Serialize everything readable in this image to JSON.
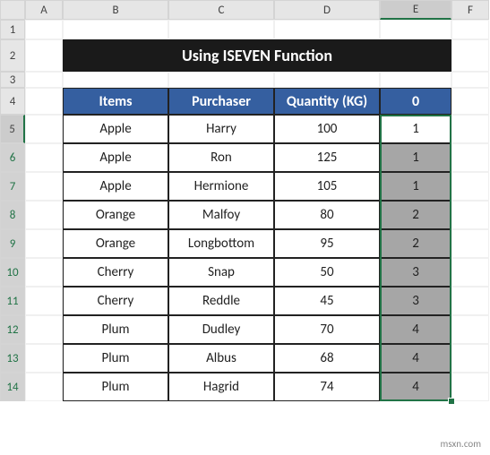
{
  "cols": [
    "A",
    "B",
    "C",
    "D",
    "E",
    "F"
  ],
  "rows": [
    "1",
    "2",
    "3",
    "4",
    "5",
    "6",
    "7",
    "8",
    "9",
    "10",
    "11",
    "12",
    "13",
    "14"
  ],
  "title": "Using ISEVEN Function",
  "headers": {
    "b": "Items",
    "c": "Purchaser",
    "d": "Quantity (KG)",
    "e": "0"
  },
  "chart_data": {
    "type": "table",
    "columns": [
      "Items",
      "Purchaser",
      "Quantity (KG)",
      "0"
    ],
    "rows": [
      {
        "item": "Apple",
        "purchaser": "Harry",
        "qty": "100",
        "grp": "1"
      },
      {
        "item": "Apple",
        "purchaser": "Ron",
        "qty": "125",
        "grp": "1"
      },
      {
        "item": "Apple",
        "purchaser": "Hermione",
        "qty": "105",
        "grp": "1"
      },
      {
        "item": "Orange",
        "purchaser": "Malfoy",
        "qty": "80",
        "grp": "2"
      },
      {
        "item": "Orange",
        "purchaser": "Longbottom",
        "qty": "95",
        "grp": "2"
      },
      {
        "item": "Cherry",
        "purchaser": "Snap",
        "qty": "50",
        "grp": "3"
      },
      {
        "item": "Cherry",
        "purchaser": "Reddle",
        "qty": "45",
        "grp": "3"
      },
      {
        "item": "Plum",
        "purchaser": "Dudley",
        "qty": "70",
        "grp": "4"
      },
      {
        "item": "Plum",
        "purchaser": "Albus",
        "qty": "68",
        "grp": "4"
      },
      {
        "item": "Plum",
        "purchaser": "Hagrid",
        "qty": "74",
        "grp": "4"
      }
    ]
  },
  "watermark": "msxn.com"
}
